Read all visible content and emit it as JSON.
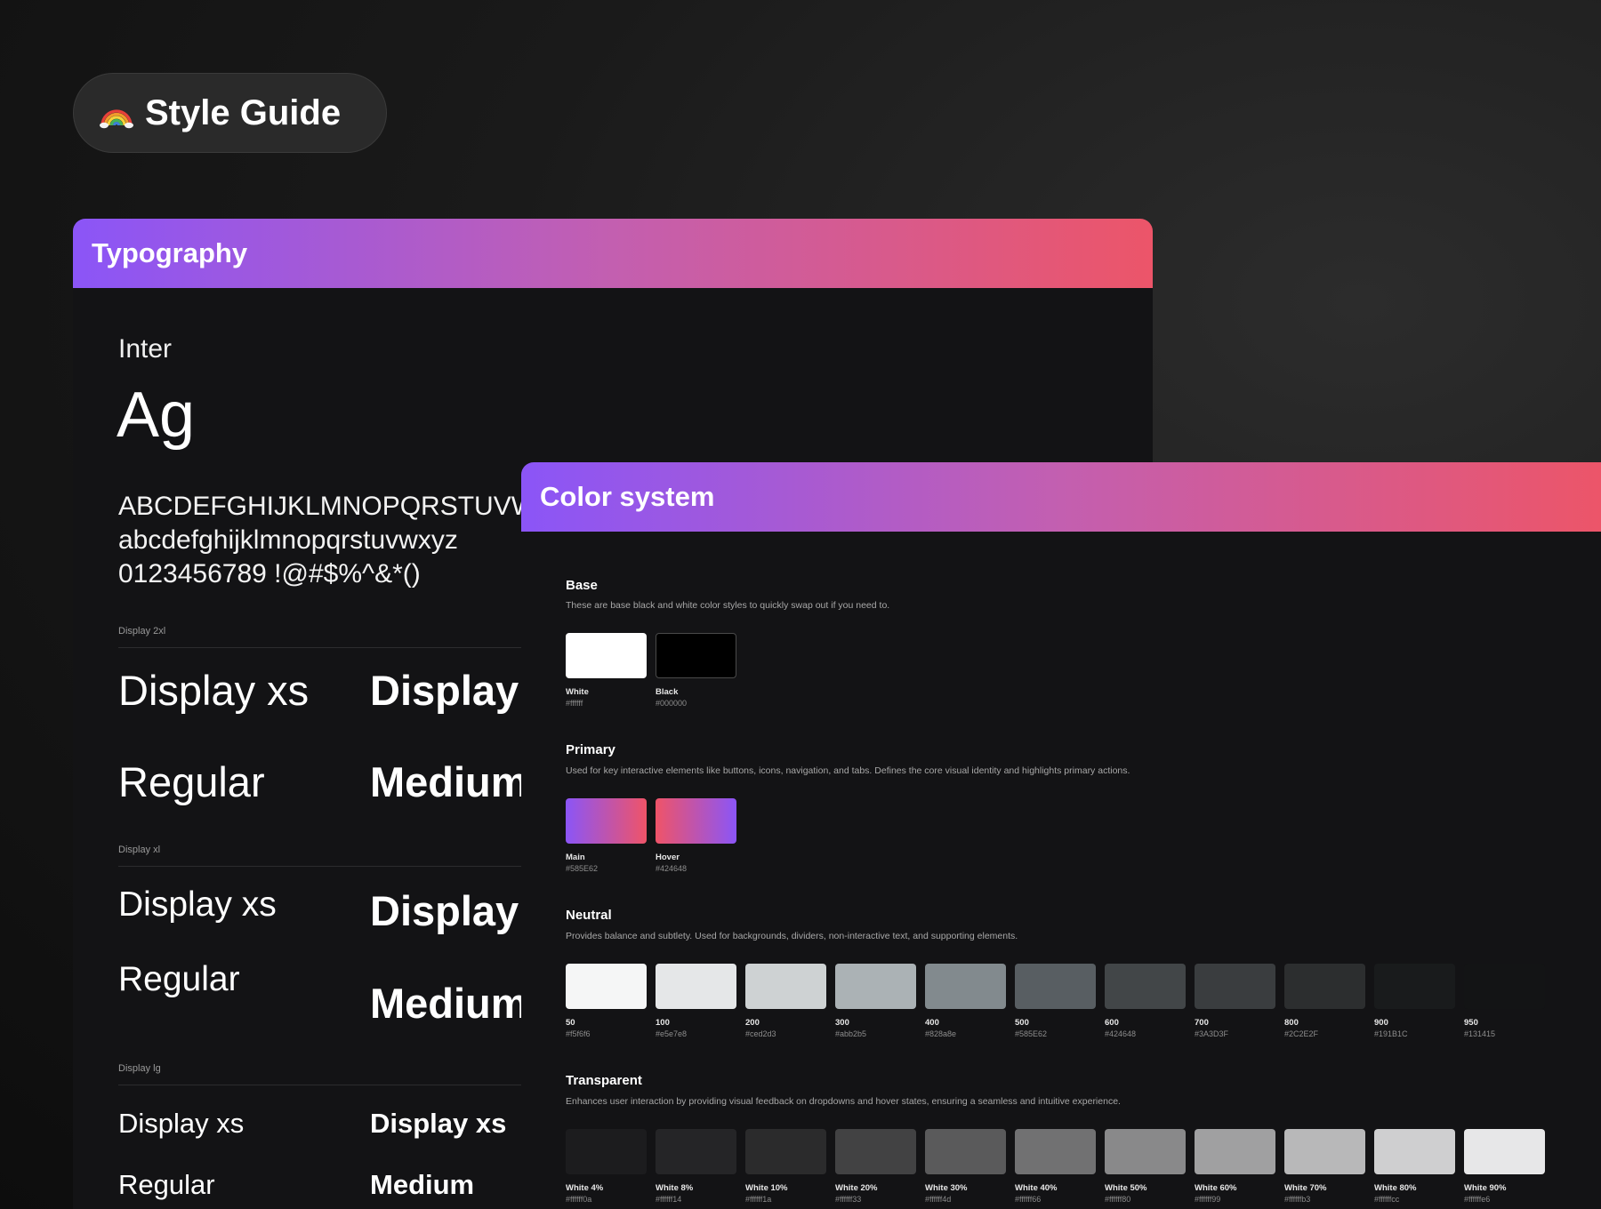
{
  "badge": {
    "title": "Style Guide",
    "icon": "rainbow-icon"
  },
  "typography": {
    "header": "Typography",
    "font_name": "Inter",
    "font_sample": "Ag",
    "charset": [
      "ABCDEFGHIJKLMNOPQRSTUVWXYZ",
      "abcdefghijklmnopqrstuvwxyz",
      "0123456789 !@#$%^&*()"
    ],
    "sections": [
      {
        "label": "Display 2xl",
        "regular_sample": "Display xs",
        "medium_sample": "Display xs",
        "regular_weight": "Regular",
        "medium_weight": "Medium"
      },
      {
        "label": "Display xl",
        "regular_sample": "Display xs",
        "medium_sample": "Display xs",
        "regular_weight": "Regular",
        "medium_weight": "Medium"
      },
      {
        "label": "Display lg",
        "regular_sample": "Display xs",
        "medium_sample": "Display xs",
        "regular_weight": "Regular",
        "medium_weight": "Medium"
      }
    ]
  },
  "colors": {
    "header": "Color system",
    "groups": [
      {
        "title": "Base",
        "description": "These are base black and white color styles to quickly swap out if you need to.",
        "swatches": [
          {
            "name": "White",
            "hex": "#ffffff",
            "fill": "#ffffff"
          },
          {
            "name": "Black",
            "hex": "#000000",
            "fill": "#000000"
          }
        ]
      },
      {
        "title": "Primary",
        "description": "Used for key interactive elements like buttons, icons, navigation, and tabs. Defines the core visual identity and highlights primary actions.",
        "swatches": [
          {
            "name": "Main",
            "hex": "#585E62",
            "fill": "linear-gradient(90deg, #8b55f7, #ef5468)"
          },
          {
            "name": "Hover",
            "hex": "#424648",
            "fill": "linear-gradient(90deg, #ef5468, #8b55f7)"
          }
        ]
      },
      {
        "title": "Neutral",
        "description": "Provides balance and subtlety. Used for backgrounds, dividers, non-interactive text, and supporting elements.",
        "swatches": [
          {
            "name": "50",
            "hex": "#f5f6f6",
            "fill": "#f5f6f6"
          },
          {
            "name": "100",
            "hex": "#e5e7e8",
            "fill": "#e5e7e8"
          },
          {
            "name": "200",
            "hex": "#ced2d3",
            "fill": "#ced2d3"
          },
          {
            "name": "300",
            "hex": "#abb2b5",
            "fill": "#abb2b5"
          },
          {
            "name": "400",
            "hex": "#828a8e",
            "fill": "#828a8e"
          },
          {
            "name": "500",
            "hex": "#585E62",
            "fill": "#585E62"
          },
          {
            "name": "600",
            "hex": "#424648",
            "fill": "#424648"
          },
          {
            "name": "700",
            "hex": "#3A3D3F",
            "fill": "#3A3D3F"
          },
          {
            "name": "800",
            "hex": "#2C2E2F",
            "fill": "#2C2E2F"
          },
          {
            "name": "900",
            "hex": "#191B1C",
            "fill": "#191B1C"
          },
          {
            "name": "950",
            "hex": "#131415",
            "fill": "#131415"
          }
        ]
      },
      {
        "title": "Transparent",
        "description": "Enhances user interaction by providing visual feedback on dropdowns and hover states, ensuring a seamless and intuitive experience.",
        "swatches": [
          {
            "name": "White 4%",
            "hex": "#ffffff0a",
            "fill": "#ffffff0a"
          },
          {
            "name": "White 8%",
            "hex": "#ffffff14",
            "fill": "#ffffff14"
          },
          {
            "name": "White 10%",
            "hex": "#ffffff1a",
            "fill": "#ffffff1a"
          },
          {
            "name": "White 20%",
            "hex": "#ffffff33",
            "fill": "#ffffff33"
          },
          {
            "name": "White 30%",
            "hex": "#ffffff4d",
            "fill": "#ffffff4d"
          },
          {
            "name": "White 40%",
            "hex": "#ffffff66",
            "fill": "#ffffff66"
          },
          {
            "name": "White 50%",
            "hex": "#ffffff80",
            "fill": "#ffffff80"
          },
          {
            "name": "White 60%",
            "hex": "#ffffff99",
            "fill": "#ffffff99"
          },
          {
            "name": "White 70%",
            "hex": "#ffffffb3",
            "fill": "#ffffffb3"
          },
          {
            "name": "White 80%",
            "hex": "#ffffffcc",
            "fill": "#ffffffcc"
          },
          {
            "name": "White 90%",
            "hex": "#ffffffe6",
            "fill": "#ffffffe6"
          }
        ]
      }
    ]
  }
}
